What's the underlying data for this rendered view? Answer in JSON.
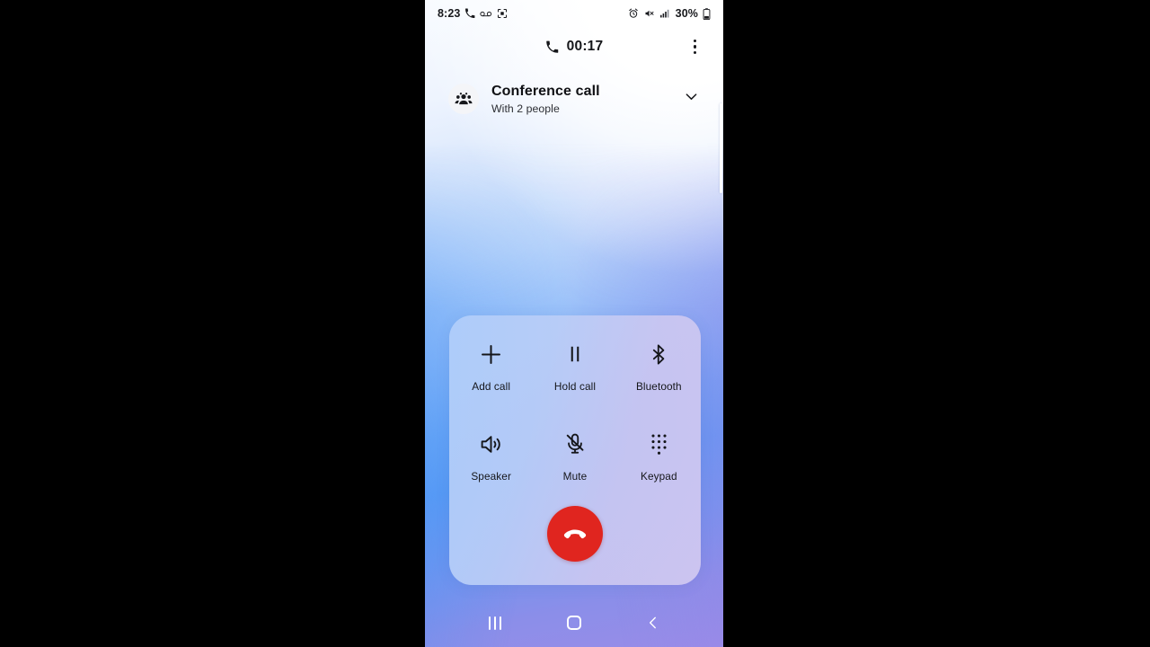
{
  "status_bar": {
    "time": "8:23",
    "battery_percent": "30%",
    "left_icons": [
      "phone-call-active-icon",
      "voicemail-icon",
      "screen-record-icon"
    ],
    "right_icons": [
      "alarm-icon",
      "sound-mute-icon",
      "signal-bars-icon",
      "battery-icon"
    ]
  },
  "call": {
    "timer": "00:17",
    "timer_icon": "phone-handset-icon",
    "overflow_label": "More options",
    "caller_name": "Conference call",
    "caller_subtitle": "With 2 people",
    "avatar_icon": "group-people-icon",
    "expand_icon": "chevron-down-icon"
  },
  "controls": [
    {
      "id": "add-call",
      "label": "Add call",
      "icon": "plus-icon"
    },
    {
      "id": "hold-call",
      "label": "Hold call",
      "icon": "pause-icon"
    },
    {
      "id": "bluetooth",
      "label": "Bluetooth",
      "icon": "bluetooth-icon"
    },
    {
      "id": "speaker",
      "label": "Speaker",
      "icon": "speaker-volume-icon"
    },
    {
      "id": "mute",
      "label": "Mute",
      "icon": "microphone-muted-icon"
    },
    {
      "id": "keypad",
      "label": "Keypad",
      "icon": "dialpad-icon"
    }
  ],
  "end_call": {
    "label": "End call",
    "icon": "end-call-handset-icon",
    "color": "#e0251f"
  },
  "nav_bar": {
    "recents_label": "Recents",
    "home_label": "Home",
    "back_label": "Back"
  },
  "theme": {
    "accent_blue": "#5b9bf5",
    "accent_purple": "#9a8ce8",
    "card_tint": "#c2d1f3",
    "end_call_red": "#e0251f",
    "text_primary": "#15161a"
  }
}
